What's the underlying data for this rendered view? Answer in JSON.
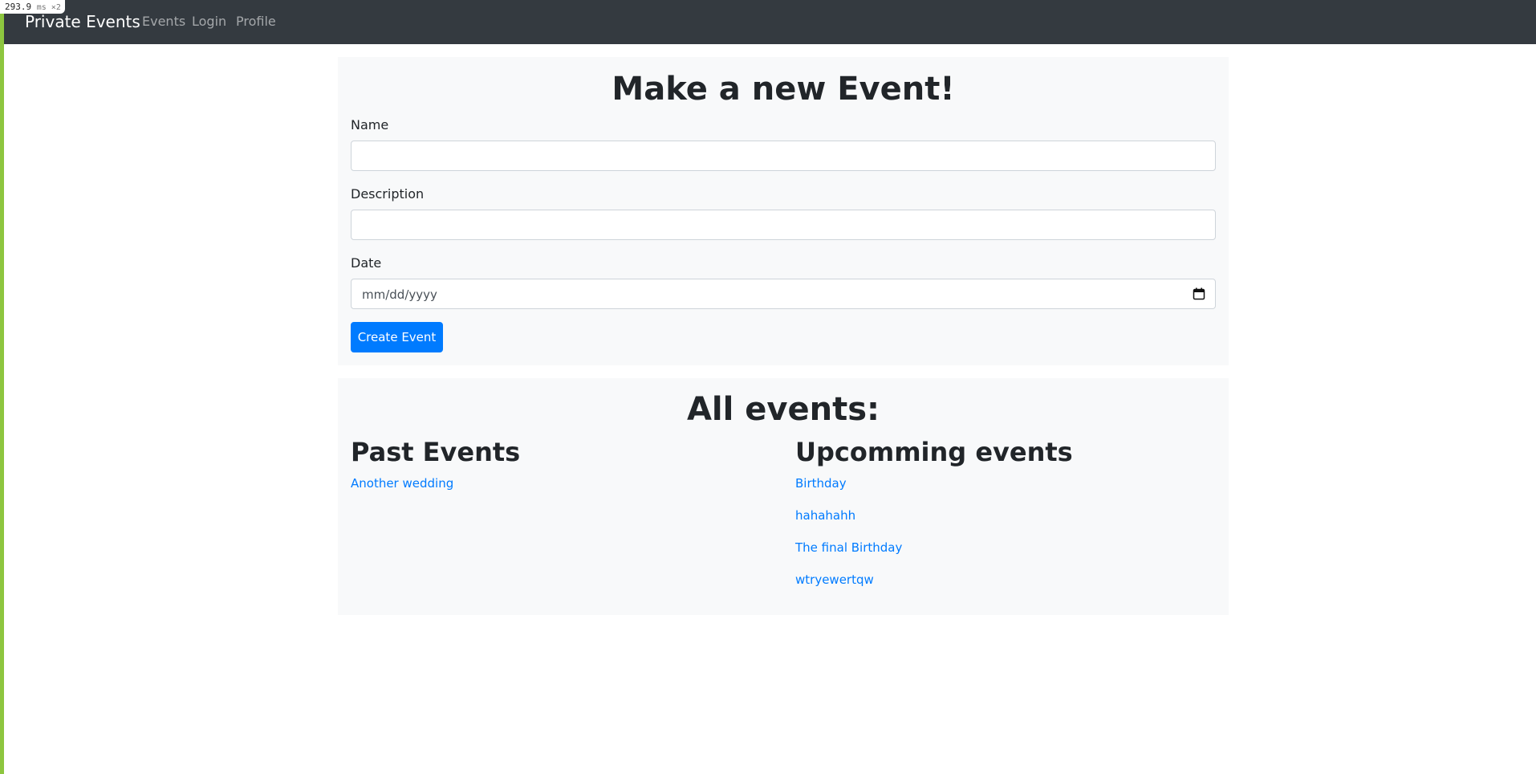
{
  "perf": {
    "value": "293.9",
    "unit": "ms ×2"
  },
  "navbar": {
    "brand": "Private Events",
    "links": [
      {
        "label": "Events"
      },
      {
        "label": "Login"
      },
      {
        "label": "Profile"
      }
    ]
  },
  "form": {
    "title": "Make a new Event!",
    "name_label": "Name",
    "name_value": "",
    "description_label": "Description",
    "description_value": "",
    "date_label": "Date",
    "date_placeholder": "mm/dd/yyyy",
    "submit_label": "Create Event"
  },
  "events": {
    "title": "All events:",
    "past": {
      "heading": "Past Events",
      "items": [
        "Another wedding"
      ]
    },
    "upcoming": {
      "heading": "Upcomming events",
      "items": [
        "Birthday",
        "hahahahh",
        "The final Birthday",
        "wtryewertqw"
      ]
    }
  },
  "colors": {
    "navbar": "#343a40",
    "card": "#f8f9fa",
    "primary": "#007bff",
    "accent_strip": "#8dc63f"
  },
  "icons": {
    "date": "calendar-icon"
  }
}
